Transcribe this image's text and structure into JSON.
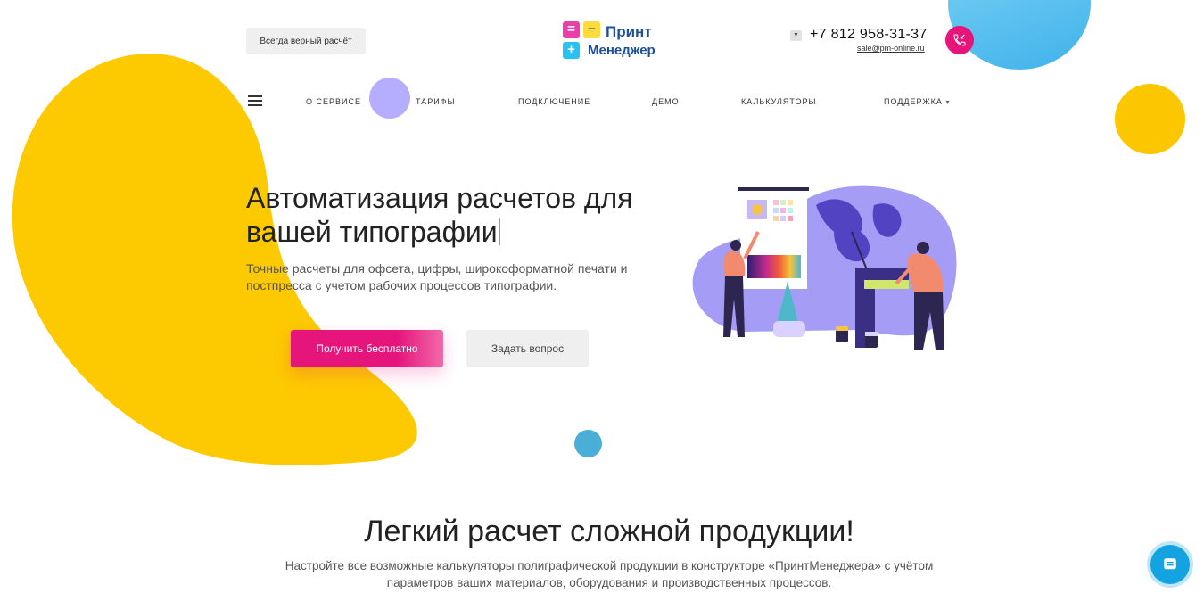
{
  "header": {
    "tag_button": "Всегда верный расчёт",
    "logo": {
      "line1": "Принт",
      "line2": "Менеджер",
      "icon_names": [
        "equals-icon",
        "minus-icon",
        "plus-icon"
      ]
    },
    "phone": "+7 812 958-31-37",
    "email": "sale@pm-online.ru",
    "city_dropdown_icon": "caret-down-icon",
    "call_icon": "phone-callback-icon"
  },
  "nav": {
    "menu_icon": "hamburger-icon",
    "items": [
      "О СЕРВИСЕ",
      "ТАРИФЫ",
      "ПОДКЛЮЧЕНИЕ",
      "ДЕМО",
      "КАЛЬКУЛЯТОРЫ",
      "ПОДДЕРЖКА"
    ],
    "dropdown_item_caret": "▾"
  },
  "hero": {
    "title_line1": "Автоматизация расчетов для",
    "title_line2": "вашей типографии",
    "subtitle": "Точные расчеты для офсета, цифры, широкоформатной печати и постпресса с учетом рабочих процессов типографии.",
    "primary_button": "Получить бесплатно",
    "secondary_button": "Задать вопрос"
  },
  "section2": {
    "title": "Легкий расчет сложной продукции!",
    "subtitle": "Настройте все возможные калькуляторы полиграфической продукции в конструкторе «ПринтМенеджера» с учётом параметров ваших материалов, оборудования и производственных процессов."
  },
  "chat": {
    "icon": "chat-icon"
  },
  "colors": {
    "accent": "#e5157c",
    "brand_blue": "#1e4f9b",
    "yellow": "#fdc700",
    "purple": "#b5aefe",
    "light_blue": "#3fb2ea"
  }
}
